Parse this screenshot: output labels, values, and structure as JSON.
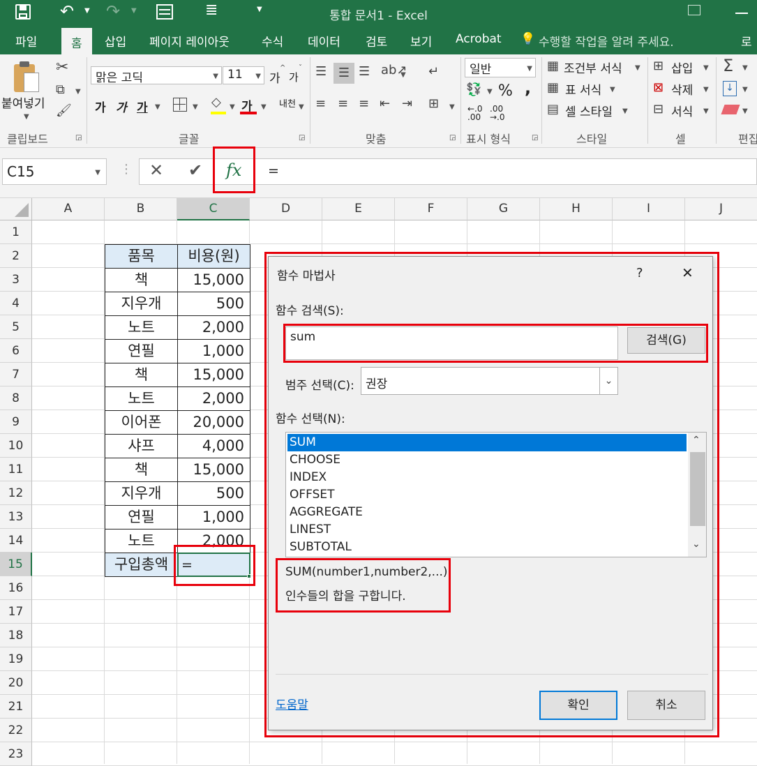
{
  "window": {
    "title": "통합 문서1 - Excel"
  },
  "tabs": [
    "파일",
    "홈",
    "삽입",
    "페이지 레이아웃",
    "수식",
    "데이터",
    "검토",
    "보기",
    "Acrobat"
  ],
  "tell_me": "수행할 작업을 알려 주세요.",
  "user_short": "로",
  "ribbon": {
    "clipboard": {
      "paste": "붙여넣기",
      "group": "클립보드"
    },
    "font": {
      "name": "맑은 고딕",
      "size": "11",
      "grow": "가",
      "shrink": "가",
      "bold": "가",
      "italic": "가",
      "underline": "가",
      "color_letter": "가",
      "phonetic": "내천",
      "group": "글꼴"
    },
    "align": {
      "group": "맞춤"
    },
    "number": {
      "format": "일반",
      "percent": "%",
      "comma": ",",
      "inc": "←.0\n.00",
      "dec": ".00\n→.0",
      "group": "표시 형식"
    },
    "styles": {
      "conditional": "조건부 서식",
      "table": "표 서식",
      "cell": "셀 스타일",
      "group": "스타일"
    },
    "cells": {
      "insert": "삽입",
      "delete": "삭제",
      "format": "서식",
      "group": "셀"
    },
    "editing": {
      "group": "편집"
    }
  },
  "formula_bar": {
    "name_box": "C15",
    "fx": "fx",
    "value": "="
  },
  "columns": [
    "A",
    "B",
    "C",
    "D",
    "E",
    "F",
    "G",
    "H",
    "I",
    "J"
  ],
  "rows": [
    "1",
    "2",
    "3",
    "4",
    "5",
    "6",
    "7",
    "8",
    "9",
    "10",
    "11",
    "12",
    "13",
    "14",
    "15",
    "16",
    "17",
    "18",
    "19",
    "20",
    "21",
    "22",
    "23"
  ],
  "table": {
    "header": [
      "품목",
      "비용(원)"
    ],
    "rows": [
      [
        "책",
        "15,000"
      ],
      [
        "지우개",
        "500"
      ],
      [
        "노트",
        "2,000"
      ],
      [
        "연필",
        "1,000"
      ],
      [
        "책",
        "15,000"
      ],
      [
        "노트",
        "2,000"
      ],
      [
        "이어폰",
        "20,000"
      ],
      [
        "샤프",
        "4,000"
      ],
      [
        "책",
        "15,000"
      ],
      [
        "지우개",
        "500"
      ],
      [
        "연필",
        "1,000"
      ],
      [
        "노트",
        "2,000"
      ]
    ],
    "total_label": "구입총액",
    "total_value": "="
  },
  "dialog": {
    "title": "함수 마법사",
    "help_glyph": "?",
    "close_glyph": "✕",
    "search_label": "함수 검색(S):",
    "search_value": "sum",
    "search_button": "검색(G)",
    "category_label": "범주 선택(C):",
    "category_value": "권장",
    "function_label": "함수 선택(N):",
    "functions": [
      "SUM",
      "CHOOSE",
      "INDEX",
      "OFFSET",
      "AGGREGATE",
      "LINEST",
      "SUBTOTAL"
    ],
    "selected_function": "SUM",
    "syntax": "SUM(number1,number2,...)",
    "description": "인수들의 합을 구합니다.",
    "help_link": "도움말",
    "ok": "확인",
    "cancel": "취소"
  },
  "colors": {
    "excel_green": "#217346",
    "selection": "#0078d7",
    "highlight": "#e8000b",
    "header_fill": "#ddebf7"
  }
}
